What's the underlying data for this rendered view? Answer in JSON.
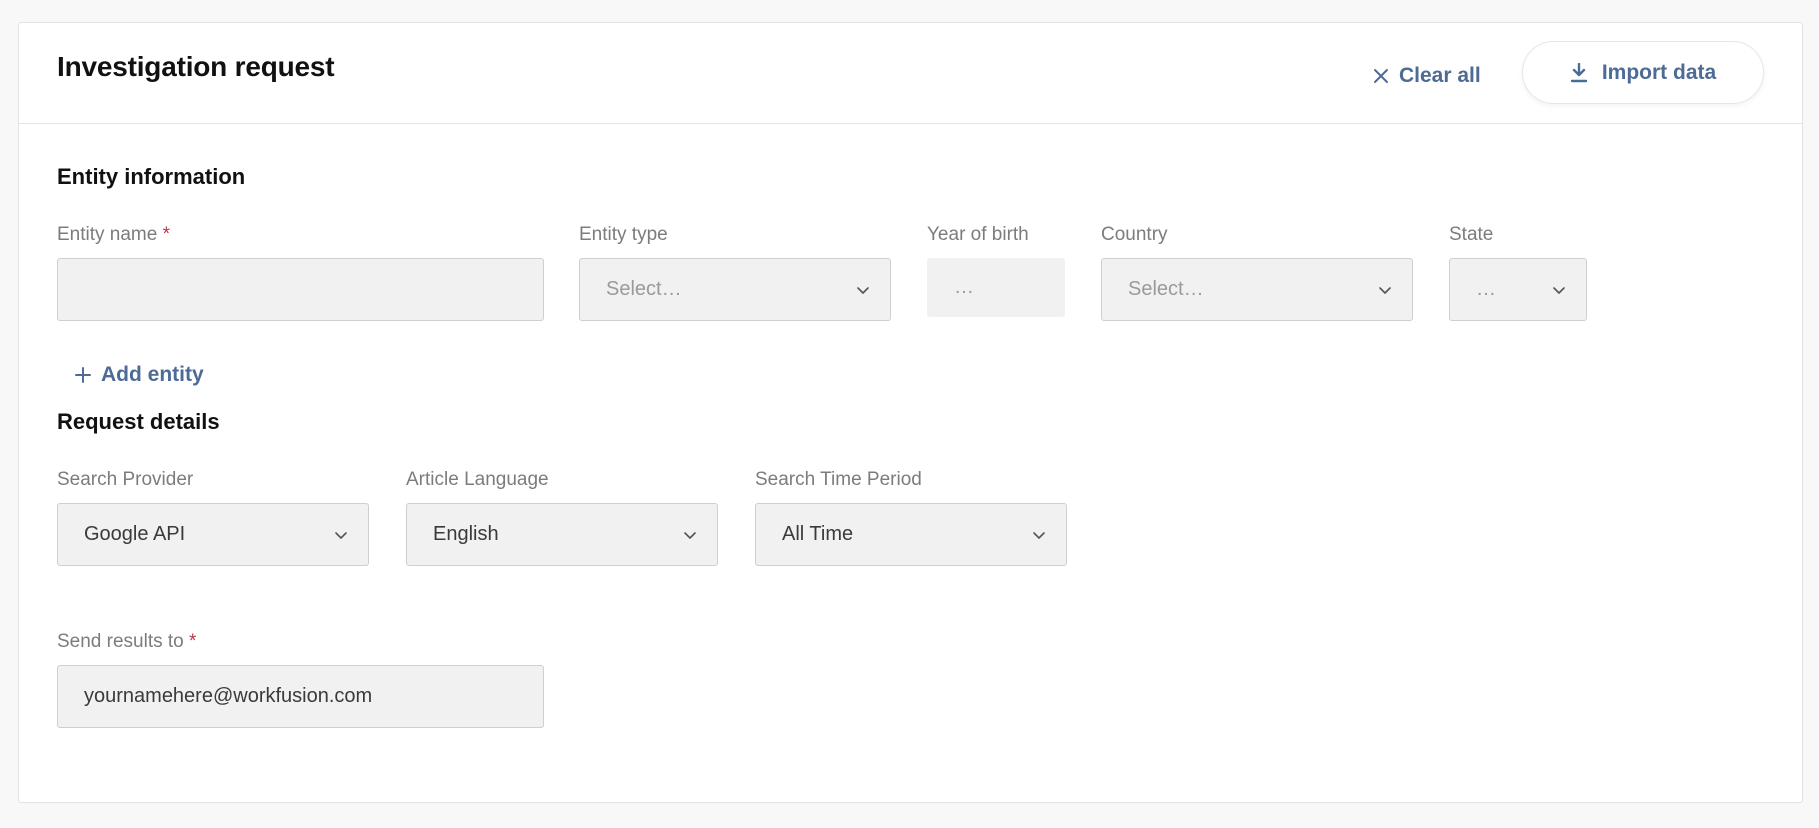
{
  "header": {
    "title": "Investigation request",
    "clear_all_label": "Clear all",
    "import_label": "Import data"
  },
  "entity_section": {
    "title": "Entity information",
    "entity_name": {
      "label": "Entity name",
      "required_mark": "*",
      "value": ""
    },
    "entity_type": {
      "label": "Entity type",
      "placeholder": "Select…"
    },
    "year_of_birth": {
      "label": "Year of birth",
      "placeholder": "…"
    },
    "country": {
      "label": "Country",
      "placeholder": "Select…"
    },
    "state": {
      "label": "State",
      "placeholder": "…"
    },
    "add_entity_label": "Add entity"
  },
  "request_section": {
    "title": "Request details",
    "search_provider": {
      "label": "Search Provider",
      "value": "Google API"
    },
    "article_language": {
      "label": "Article Language",
      "value": "English"
    },
    "search_time_period": {
      "label": "Search Time Period",
      "value": "All Time"
    },
    "send_results": {
      "label": "Send results to",
      "required_mark": "*",
      "value": "yournamehere@workfusion.com"
    }
  },
  "colors": {
    "accent": "#4d6b96",
    "required": "#c0344a",
    "field_bg": "#f1f1f1"
  }
}
